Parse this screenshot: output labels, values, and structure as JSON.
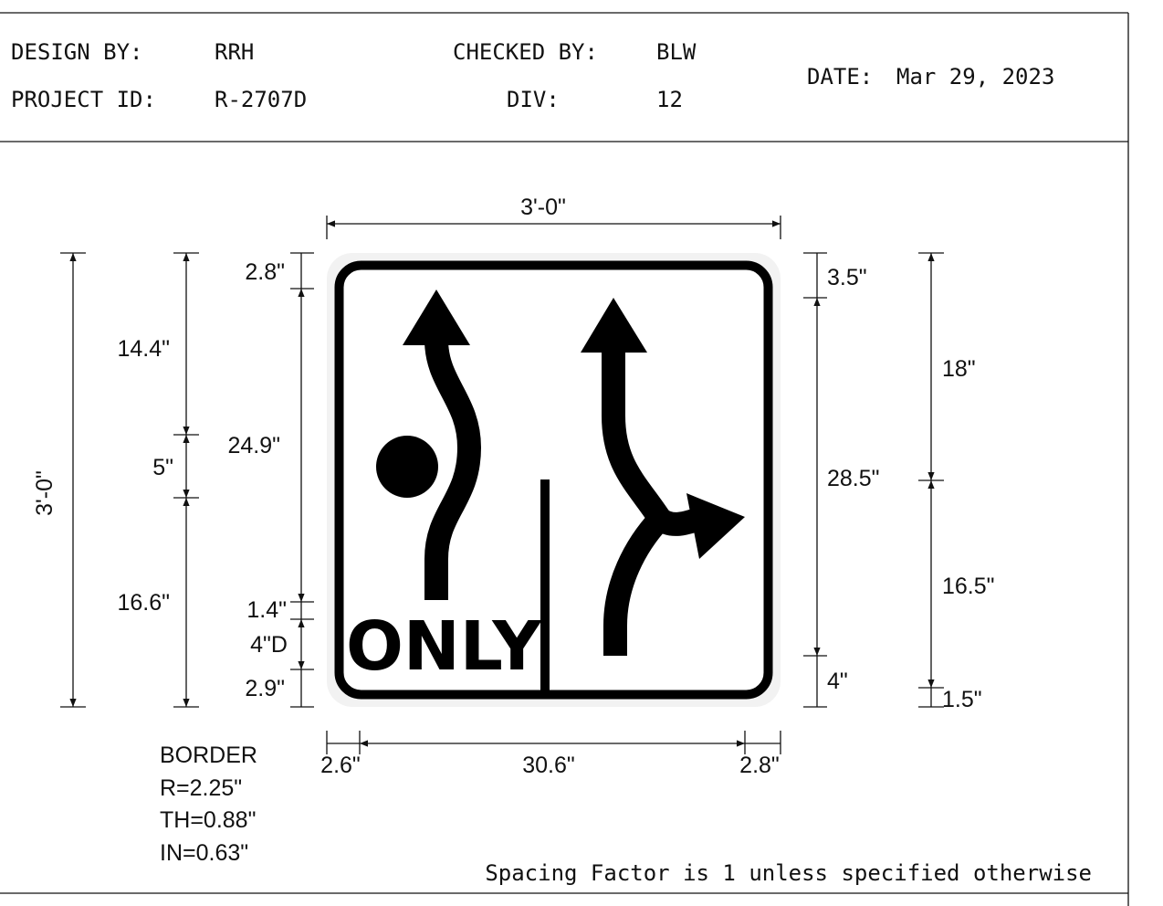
{
  "title_block": {
    "design_by_label": "DESIGN BY:",
    "design_by_value": "RRH",
    "checked_by_label": "CHECKED BY:",
    "checked_by_value": "BLW",
    "date_label": "DATE:",
    "date_value": "Mar 29, 2023",
    "project_id_label": "PROJECT ID:",
    "project_id_value": "R-2707D",
    "div_label": "DIV:",
    "div_value": "12"
  },
  "sign": {
    "legend": "ONLY",
    "symbols": [
      "curved-ahead-arrow-with-dot",
      "curved-ahead-and-right-turn-arrow"
    ],
    "colors": {
      "background": "#ffffff",
      "legend": "#000000",
      "border": "#000000"
    }
  },
  "dimensions": {
    "top_width": "3'-0\"",
    "left_overall_height": "3'-0\"",
    "left_14_4": "14.4\"",
    "left_5": "5\"",
    "left_16_6": "16.6\"",
    "left_2_8": "2.8\"",
    "left_24_9": "24.9\"",
    "left_1_4": "1.4\"",
    "left_4d": "4\"D",
    "left_2_9": "2.9\"",
    "right_3_5": "3.5\"",
    "right_28_5": "28.5\"",
    "right_4": "4\"",
    "right_18": "18\"",
    "right_16_5": "16.5\"",
    "right_1_5": "1.5\"",
    "bottom_2_6": "2.6\"",
    "bottom_30_6": "30.6\"",
    "bottom_2_8": "2.8\""
  },
  "border_note": {
    "title": "BORDER",
    "radius": "R=2.25\"",
    "thickness": "TH=0.88\"",
    "inset": "IN=0.63\""
  },
  "footer_note": "Spacing Factor is 1 unless specified otherwise"
}
